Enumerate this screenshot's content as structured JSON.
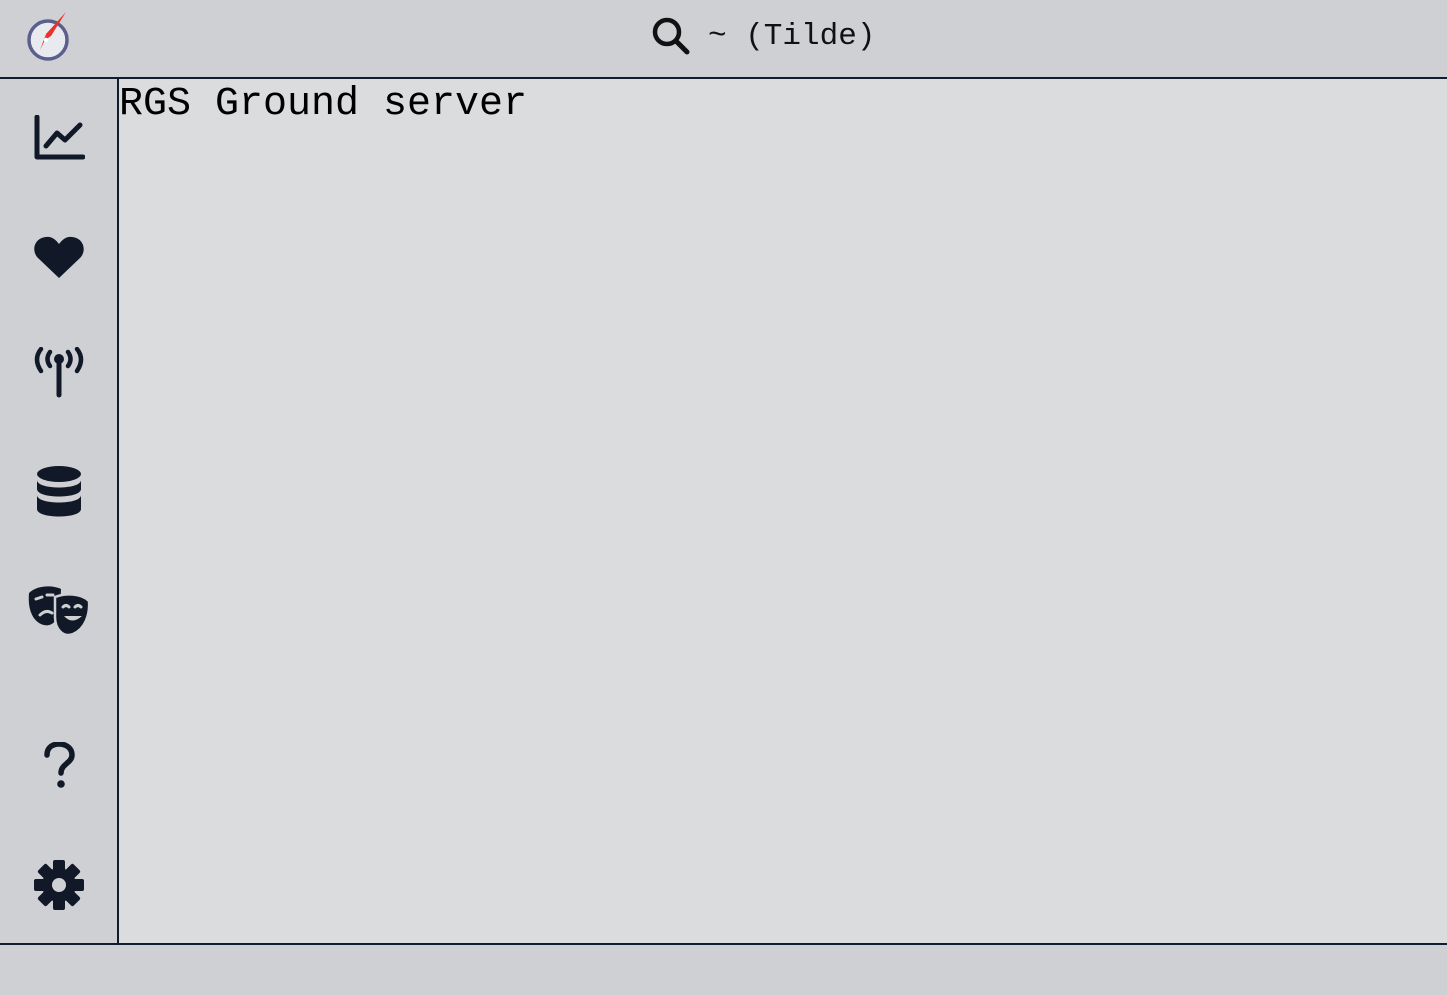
{
  "header": {
    "logo_icon": "compass-logo-icon",
    "search_icon": "search-icon",
    "search_label": "~ (Tilde)"
  },
  "sidebar": {
    "items": [
      {
        "id": "charts",
        "icon": "line-chart-icon"
      },
      {
        "id": "health",
        "icon": "heart-icon"
      },
      {
        "id": "telemetry",
        "icon": "broadcast-tower-icon"
      },
      {
        "id": "database",
        "icon": "database-icon"
      },
      {
        "id": "theater",
        "icon": "theater-masks-icon"
      },
      {
        "id": "help",
        "icon": "question-mark-icon"
      },
      {
        "id": "settings",
        "icon": "gear-icon"
      }
    ]
  },
  "main": {
    "title": "RGS Ground server"
  },
  "colors": {
    "background": "#dbdcde",
    "chrome": "#cfd0d4",
    "border": "#0f1e2e",
    "icon": "#111827",
    "logo_ring": "#5a5f8c",
    "logo_needle": "#e8332a"
  }
}
